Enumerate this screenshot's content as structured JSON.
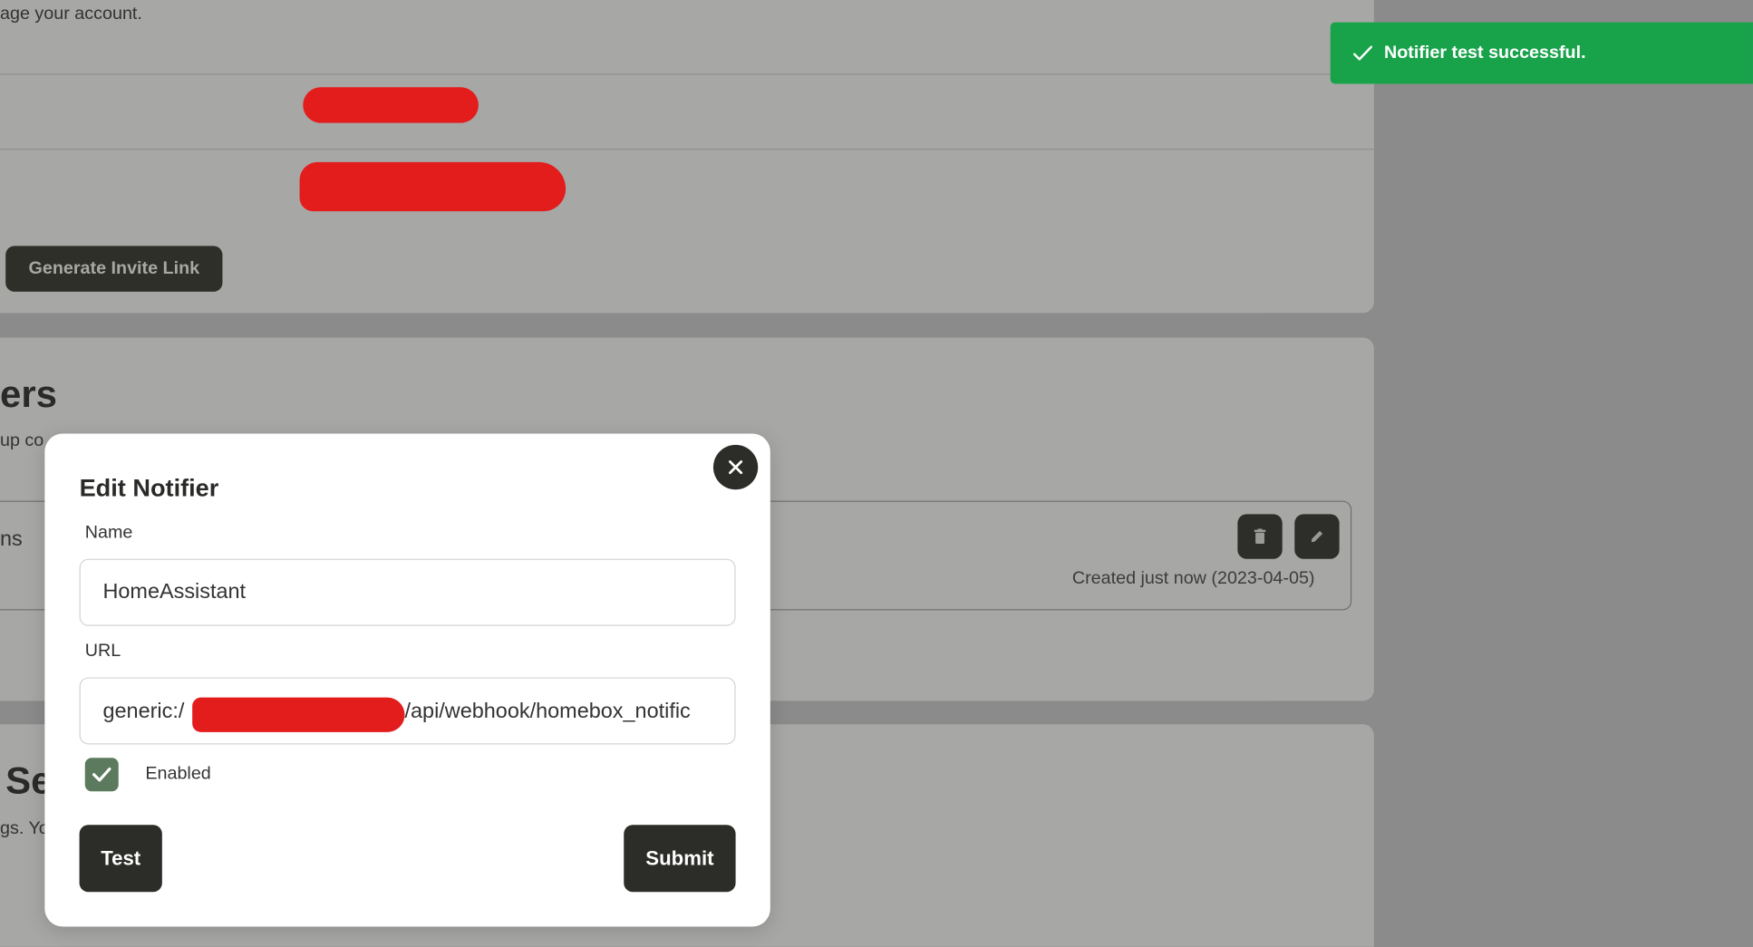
{
  "background": {
    "account_text": "age your account.",
    "invite_button_label": "Generate Invite Link",
    "notifiers_title_fragment": "ers",
    "notifiers_desc_fragment": "up co",
    "row_left_fragment": "ns",
    "created_text": "Created just now (2023-04-05)",
    "settings_title_fragment": "Se",
    "settings_desc_fragment": "gs. Yo",
    "row_icons": [
      "trash-icon",
      "pencil-icon"
    ]
  },
  "toast": {
    "message": "Notifier test successful.",
    "icon": "check-icon",
    "color": "#18a34a"
  },
  "modal": {
    "title": "Edit Notifier",
    "name_label": "Name",
    "name_value": "HomeAssistant",
    "url_label": "URL",
    "url_prefix": "generic:/",
    "url_suffix": "/api/webhook/homebox_notific",
    "enabled_label": "Enabled",
    "enabled": true,
    "test_label": "Test",
    "submit_label": "Submit",
    "close_icon": "close-icon"
  }
}
